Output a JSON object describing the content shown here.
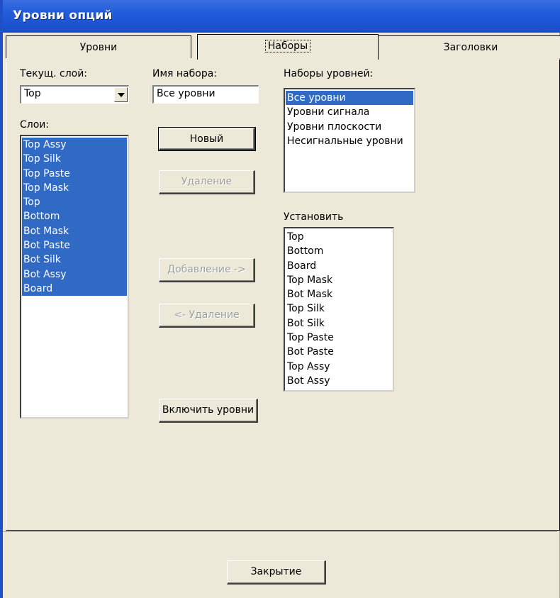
{
  "window": {
    "title": "Уровни опций"
  },
  "tabs": [
    {
      "label": "Уровни"
    },
    {
      "label": "Наборы"
    },
    {
      "label": "Заголовки"
    }
  ],
  "current_layer": {
    "label": "Текущ. слой:",
    "value": "Top"
  },
  "set_name": {
    "label": "Имя набора:",
    "value": "Все уровни"
  },
  "layers": {
    "label": "Слои:",
    "items": [
      "Top Assy",
      "Top Silk",
      "Top Paste",
      "Top Mask",
      "Top",
      "Bottom",
      "Bot Mask",
      "Bot Paste",
      "Bot Silk",
      "Bot Assy",
      "Board"
    ]
  },
  "buttons": {
    "new": "Новый",
    "delete": "Удаление",
    "add": "Добавление ->",
    "remove": "<- Удаление",
    "include": "Включить уровни",
    "close": "Закрытие"
  },
  "level_sets": {
    "label": "Наборы уровней:",
    "items": [
      "Все уровни",
      "Уровни сигнала",
      "Уровни плоскости",
      "Несигнальные уровни"
    ],
    "selected_index": 0
  },
  "install": {
    "label": "Установить",
    "items": [
      "Top",
      "Bottom",
      "Board",
      "Top Mask",
      "Bot Mask",
      "Top Silk",
      "Bot Silk",
      "Top Paste",
      "Bot Paste",
      "Top Assy",
      "Bot Assy"
    ]
  },
  "colors": {
    "titlebar": "#245edb",
    "selection": "#316ac5",
    "face": "#ece9d8"
  }
}
